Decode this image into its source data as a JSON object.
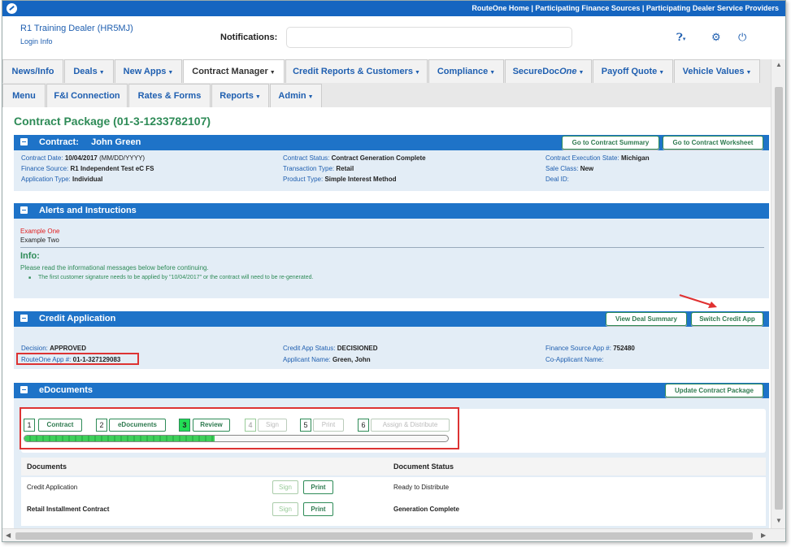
{
  "topbar": {
    "links": "RouteOne Home | Participating Finance Sources | Participating Dealer Service Providers"
  },
  "header": {
    "dealer": "R1 Training Dealer (HR5MJ)",
    "login": "Login Info",
    "notifications_label": "Notifications:",
    "notifications_value": ""
  },
  "nav": {
    "row1": [
      "News/Info",
      "Deals",
      "New Apps",
      "Contract Manager",
      "Credit Reports & Customers",
      "Compliance",
      "SecureDocOne",
      "Payoff Quote",
      "Vehicle Values"
    ],
    "row2": [
      "Menu",
      "F&I Connection",
      "Rates & Forms",
      "Reports",
      "Admin"
    ]
  },
  "page_title": "Contract Package (01-3-1233782107)",
  "contract": {
    "title": "Contract:",
    "name": "John Green",
    "btn_summary": "Go to Contract Summary",
    "btn_worksheet": "Go to Contract Worksheet",
    "date_k": "Contract Date:",
    "date_v": "10/04/2017",
    "date_fmt": "(MM/DD/YYYY)",
    "fs_k": "Finance Source:",
    "fs_v": "R1 Independent Test eC FS",
    "at_k": "Application Type:",
    "at_v": "Individual",
    "cs_k": "Contract Status:",
    "cs_v": "Contract Generation Complete",
    "tt_k": "Transaction Type:",
    "tt_v": "Retail",
    "pt_k": "Product Type:",
    "pt_v": "Simple Interest Method",
    "ces_k": "Contract Execution State:",
    "ces_v": "Michigan",
    "sc_k": "Sale Class:",
    "sc_v": "New",
    "deal_k": "Deal ID:",
    "deal_v": ""
  },
  "alerts": {
    "title": "Alerts and Instructions",
    "example1": "Example One",
    "example2": "Example Two",
    "info_title": "Info:",
    "info_msg": "Please read the informational messages below before continuing.",
    "info_bullet": "The first customer signature needs to be applied by \"10/04/2017\" or the contract will need to be re-generated."
  },
  "credit": {
    "title": "Credit Application",
    "btn_view": "View Deal Summary",
    "btn_switch": "Switch Credit App",
    "dec_k": "Decision:",
    "dec_v": "APPROVED",
    "r1_k": "RouteOne App #:",
    "r1_v": "01-1-327129083",
    "cas_k": "Credit App Status:",
    "cas_v": "DECISIONED",
    "an_k": "Applicant Name:",
    "an_v": "Green, John",
    "fsa_k": "Finance Source App #:",
    "fsa_v": "752480",
    "ca_k": "Co-Applicant Name:",
    "ca_v": ""
  },
  "edocs": {
    "title": "eDocuments",
    "btn_update": "Update Contract Package",
    "steps": [
      {
        "num": "1",
        "label": "Contract"
      },
      {
        "num": "2",
        "label": "eDocuments"
      },
      {
        "num": "3",
        "label": "Review"
      },
      {
        "num": "4",
        "label": "Sign"
      },
      {
        "num": "5",
        "label": "Print"
      },
      {
        "num": "6",
        "label": "Assign & Distribute"
      }
    ],
    "progress": 0.45,
    "col_docs": "Documents",
    "col_status": "Document Status",
    "rows": [
      {
        "name": "Credit Application",
        "sign": "Sign",
        "print": "Print",
        "status": "Ready to Distribute"
      },
      {
        "name": "Retail Installment Contract",
        "sign": "Sign",
        "print": "Print",
        "status": "Generation Complete"
      }
    ]
  },
  "colors": {
    "brand_blue": "#1e73c8",
    "green": "#2e8b57",
    "highlight_red": "#d33"
  }
}
